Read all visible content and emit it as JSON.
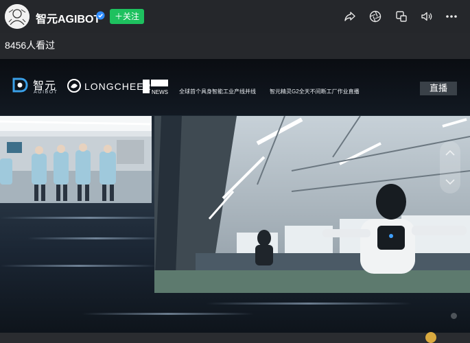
{
  "header": {
    "channel_name": "智元AGIBOT",
    "follow_label": "＋关注",
    "icons": [
      "share-icon",
      "aperture-icon",
      "picture-in-picture-icon",
      "volume-icon",
      "more-icon"
    ]
  },
  "stream": {
    "viewer_count": "8456人看过"
  },
  "banner": {
    "agibot_cn": "智元",
    "agibot_en": "AGIBOT",
    "longcheer": "LONGCHEER",
    "news_logo_text": "NEWS",
    "caption_left": "全球首个具身智能工业产线并线",
    "caption_right": "智元精灵G2全天不间断工厂作业直播",
    "live_label": "直播"
  },
  "colors": {
    "follow_green": "#1ec15f",
    "verified_blue": "#2f8cff",
    "background": "#1a1c20"
  }
}
